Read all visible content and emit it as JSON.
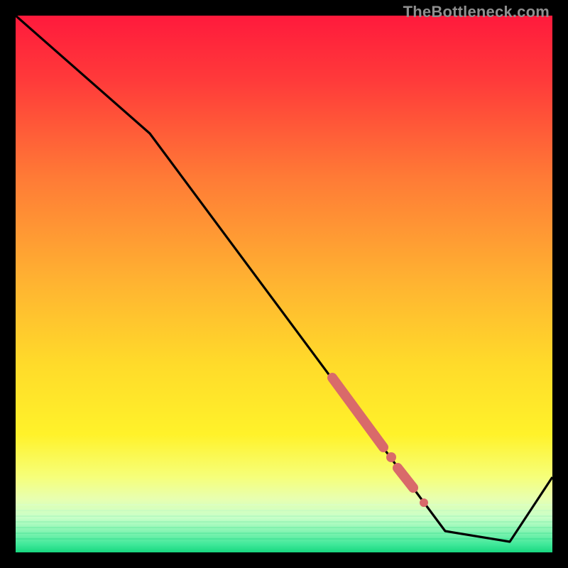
{
  "watermark": "TheBottleneck.com",
  "chart_data": {
    "type": "line",
    "title": "",
    "xlabel": "",
    "ylabel": "",
    "xlim": [
      0,
      100
    ],
    "ylim": [
      0,
      100
    ],
    "background": "red-yellow-green-vertical-gradient",
    "series": [
      {
        "name": "curve",
        "stroke": "#000000",
        "x": [
          0,
          25,
          80,
          92,
          100
        ],
        "y": [
          100,
          78,
          4,
          2,
          14
        ]
      }
    ],
    "markers": [
      {
        "name": "thick-segment-1",
        "type": "line-segment",
        "stroke": "#d96a6a",
        "stroke_width": 14,
        "linecap": "round",
        "x": [
          59,
          68.5
        ],
        "y": [
          32.5,
          19.5
        ]
      },
      {
        "name": "dot-1",
        "type": "point",
        "fill": "#d96a6a",
        "radius": 7,
        "x": 70.0,
        "y": 17.7
      },
      {
        "name": "thick-segment-2",
        "type": "line-segment",
        "stroke": "#d96a6a",
        "stroke_width": 14,
        "linecap": "round",
        "x": [
          71.2,
          74.0
        ],
        "y": [
          15.8,
          12.0
        ]
      },
      {
        "name": "dot-2",
        "type": "point",
        "fill": "#d96a6a",
        "radius": 6,
        "x": 76.0,
        "y": 9.3
      }
    ]
  }
}
